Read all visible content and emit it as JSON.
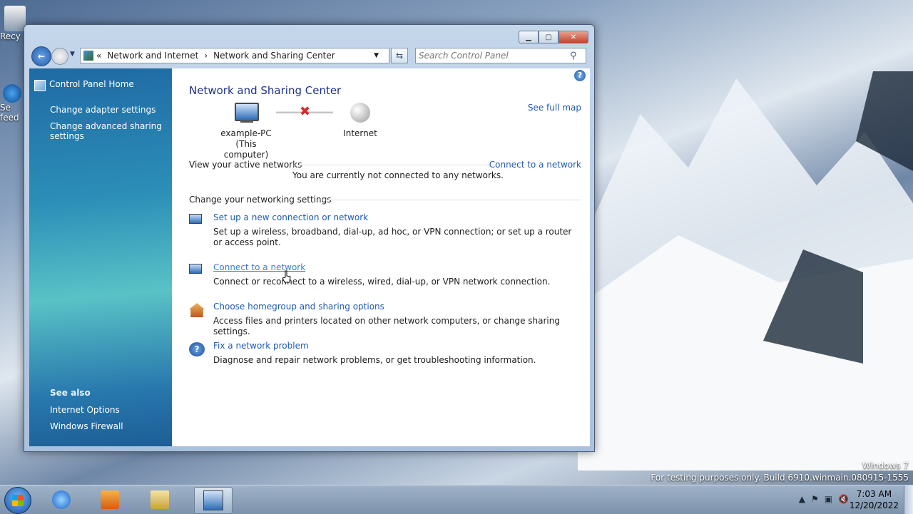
{
  "desktop": {
    "icons": [
      {
        "label": "Recy"
      },
      {
        "label": "Se feed"
      }
    ],
    "watermark_line1": "Windows 7",
    "watermark_line2": "For testing purposes only. Build 6910.winmain.080915-1555"
  },
  "window": {
    "breadcrumb": [
      "Network and Internet",
      "Network and Sharing Center"
    ],
    "search_placeholder": "Search Control Panel",
    "sidebar": {
      "home": "Control Panel Home",
      "links": [
        "Change adapter settings",
        "Change advanced sharing settings"
      ],
      "see_also_title": "See also",
      "see_also_links": [
        "Internet Options",
        "Windows Firewall"
      ]
    },
    "main": {
      "title": "Network and Sharing Center",
      "see_full_map": "See full map",
      "computer_name": "example-PC",
      "computer_sub": "(This computer)",
      "internet_label": "Internet",
      "active_networks_label": "View your active networks",
      "connect_link": "Connect to a network",
      "not_connected_text": "You are currently not connected to any networks.",
      "settings_label": "Change your networking settings",
      "tasks": [
        {
          "icon": "network-setup-icon",
          "title": "Set up a new connection or network",
          "desc": "Set up a wireless, broadband, dial-up, ad hoc, or VPN connection; or set up a router or access point."
        },
        {
          "icon": "connect-network-icon",
          "title": "Connect to a network",
          "desc": "Connect or reconnect to a wireless, wired, dial-up, or VPN network connection."
        },
        {
          "icon": "homegroup-icon",
          "title": "Choose homegroup and sharing options",
          "desc": "Access files and printers located on other network computers, or change sharing settings."
        },
        {
          "icon": "help-icon",
          "title": "Fix a network problem",
          "desc": "Diagnose and repair network problems, or get troubleshooting information."
        }
      ]
    }
  },
  "taskbar": {
    "time": "7:03 AM",
    "date": "12/20/2022"
  }
}
